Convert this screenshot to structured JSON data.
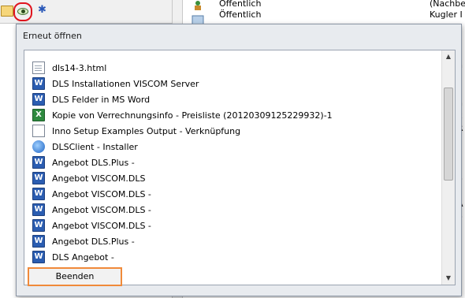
{
  "background": {
    "rows": [
      {
        "text": "Öffentlich",
        "right": "(Nachbe",
        "edge": ""
      },
      {
        "text": "Öffentlich",
        "right": "Kugler I",
        "edge": ""
      }
    ],
    "right_edge_letters": [
      "s",
      "n",
      "/",
      "/",
      "n",
      "k",
      "R",
      "u",
      "c",
      "i",
      "o",
      "d",
      "A",
      "o",
      "t",
      "c",
      "c",
      "c",
      "/"
    ]
  },
  "dialog": {
    "title": "Erneut öffnen",
    "items": [
      {
        "icon": "html-file-icon",
        "label": "dls14-3.html"
      },
      {
        "icon": "word-document-icon",
        "label": "DLS Installationen VISCOM Server"
      },
      {
        "icon": "word-document-icon",
        "label": "DLS Felder in MS Word"
      },
      {
        "icon": "excel-spreadsheet-icon",
        "label": "Kopie von Verrechnungsinfo - Preisliste (20120309125229932)-1"
      },
      {
        "icon": "document-icon",
        "label": "Inno Setup Examples Output - Verknüpfung"
      },
      {
        "icon": "setup-installer-icon",
        "label": "DLSClient - Installer"
      },
      {
        "icon": "word-document-icon",
        "label": "Angebot DLS.Plus - "
      },
      {
        "icon": "word-document-icon",
        "label": "Angebot VISCOM.DLS"
      },
      {
        "icon": "word-document-icon",
        "label": "Angebot VISCOM.DLS - "
      },
      {
        "icon": "word-document-icon",
        "label": "Angebot VISCOM.DLS - "
      },
      {
        "icon": "word-document-icon",
        "label": "Angebot VISCOM.DLS - "
      },
      {
        "icon": "word-document-icon",
        "label": "Angebot DLS.Plus - "
      },
      {
        "icon": "word-document-icon",
        "label": "DLS Angebot - "
      }
    ],
    "close_button": "Beenden"
  }
}
